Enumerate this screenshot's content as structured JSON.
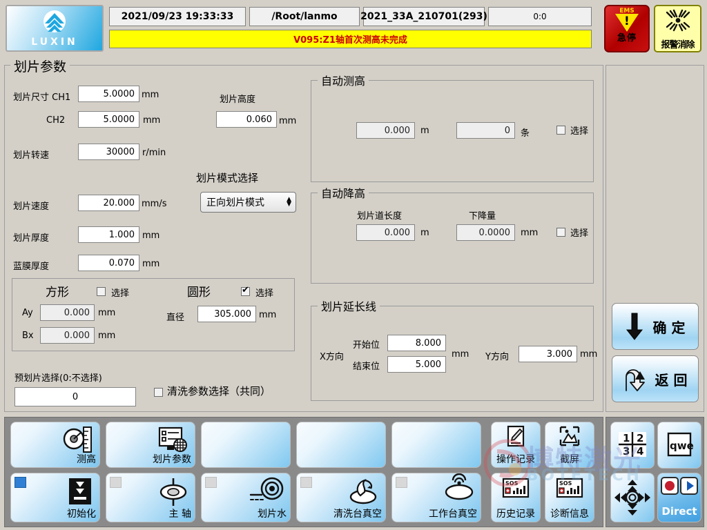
{
  "header": {
    "logo_text": "LUXIN",
    "datetime": "2021/09/23 19:33:33",
    "path": "/Root/lanmo",
    "recipe": "2021_33A_210701(293)",
    "counter": "0:0",
    "alarm_message": "V095:Z1轴首次测高未完成",
    "ems_label_en": "EMS",
    "ems_label_cn": "急停",
    "alarm_clear_label": "报警消除",
    "alarm_bg_color": "#ffff00",
    "alarm_text_color": "#cc0000",
    "ems_color": "#c81010"
  },
  "main": {
    "title": "划片参数",
    "size_label": "划片尺寸 CH1",
    "size_ch1_value": "5.0000",
    "size_ch1_unit": "mm",
    "ch2_label": "CH2",
    "size_ch2_value": "5.0000",
    "size_ch2_unit": "mm",
    "height_label": "划片高度",
    "height_value": "0.060",
    "height_unit": "mm",
    "speed_rot_label": "划片转速",
    "speed_rot_value": "30000",
    "speed_rot_unit": "r/min",
    "speed_label": "划片速度",
    "speed_value": "20.000",
    "speed_unit": "mm/s",
    "mode_label": "划片模式选择",
    "mode_value": "正向划片模式",
    "thickness_label": "划片厚度",
    "thickness_value": "1.000",
    "thickness_unit": "mm",
    "bluefilm_label": "蓝膜厚度",
    "bluefilm_value": "0.070",
    "bluefilm_unit": "mm",
    "prescribe_label": "预划片选择(0:不选择)",
    "prescribe_value": "0",
    "clean_param_label": "清洗参数选择（共同）",
    "clean_param_checked": false
  },
  "shape": {
    "square_title": "方形",
    "square_select_label": "选择",
    "square_checked": false,
    "ay_label": "Ay",
    "ay_value": "0.000",
    "ay_unit": "mm",
    "bx_label": "Bx",
    "bx_value": "0.000",
    "bx_unit": "mm",
    "circle_title": "圆形",
    "circle_select_label": "选择",
    "circle_checked": true,
    "diameter_label": "直径",
    "diameter_value": "305.000",
    "diameter_unit": "mm"
  },
  "auto_height": {
    "title": "自动测高",
    "length_value": "0.000",
    "length_unit": "m",
    "count_value": "0",
    "count_unit": "条",
    "select_label": "选择",
    "checked": false
  },
  "auto_down": {
    "title": "自动降高",
    "lane_length_label": "划片道长度",
    "lane_length_value": "0.000",
    "lane_length_unit": "m",
    "drop_label": "下降量",
    "drop_value": "0.0000",
    "drop_unit": "mm",
    "select_label": "选择",
    "checked": false
  },
  "extension": {
    "title": "划片延长线",
    "x_dir_label": "X方向",
    "start_label": "开始位",
    "start_value": "8.000",
    "end_label": "结束位",
    "end_value": "5.000",
    "x_unit": "mm",
    "y_dir_label": "Y方向",
    "y_value": "3.000",
    "y_unit": "mm"
  },
  "actions": {
    "confirm_label": "确 定",
    "back_label": "返 回"
  },
  "toolbar": {
    "row1": [
      {
        "label": "测高",
        "icon": "gauge-ruler-icon",
        "lamp": null,
        "blank": false
      },
      {
        "label": "划片参数",
        "icon": "parameter-list-icon",
        "lamp": null,
        "blank": false
      },
      {
        "label": "",
        "icon": "blank-icon",
        "lamp": null,
        "blank": true
      },
      {
        "label": "",
        "icon": "blank-icon",
        "lamp": null,
        "blank": true
      },
      {
        "label": "",
        "icon": "blank-icon",
        "lamp": null,
        "blank": true
      }
    ],
    "row2": [
      {
        "label": "初始化",
        "icon": "download-arrow-icon",
        "lamp": "on",
        "blank": false
      },
      {
        "label": "主 轴",
        "icon": "spindle-icon",
        "lamp": "off",
        "blank": false
      },
      {
        "label": "划片水",
        "icon": "water-spray-icon",
        "lamp": "off",
        "blank": false
      },
      {
        "label": "清洗台真空",
        "icon": "clean-vacuum-icon",
        "lamp": "off",
        "blank": false
      },
      {
        "label": "工作台真空",
        "icon": "table-vacuum-icon",
        "lamp": "off",
        "blank": false
      }
    ],
    "small": [
      {
        "label": "操作记录",
        "icon": "pencil-note-icon"
      },
      {
        "label": "截屏",
        "icon": "screenshot-icon"
      },
      {
        "label": "历史记录",
        "icon": "sos-chart-icon"
      },
      {
        "label": "诊断信息",
        "icon": "sos-chart-icon"
      }
    ],
    "side": [
      {
        "label": "",
        "icon": "quad-grid-icon",
        "digits": [
          "1",
          "2",
          "3",
          "4"
        ]
      },
      {
        "label": "",
        "icon": "keyboard-qwe-icon",
        "text": "qwe"
      },
      {
        "label": "",
        "icon": "joystick-nav-icon"
      },
      {
        "label": "Direct",
        "icon": "record-play-icon"
      }
    ]
  },
  "watermark": {
    "cn": "博特激光",
    "en": "BOTETECH"
  }
}
